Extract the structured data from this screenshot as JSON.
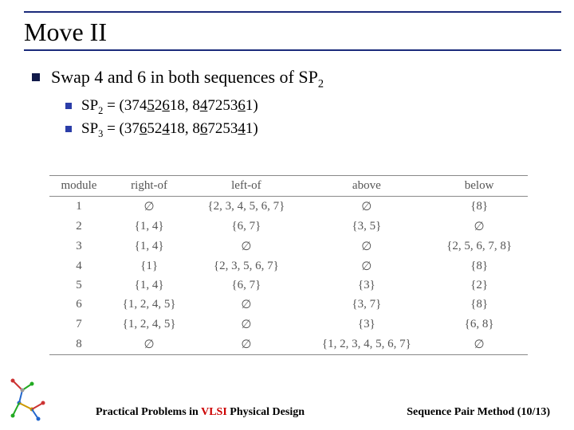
{
  "title": "Move II",
  "main_bullet": {
    "pre": "Swap 4 and 6 in both sequences of SP",
    "sub_num": "2"
  },
  "sp2": {
    "label_pre": "SP",
    "label_sub": "2",
    "eq": " = (374",
    "u1": "5",
    "mid1": "2",
    "u2": "6",
    "mid2": "18, 8",
    "u3": "4",
    "mid3": "7253",
    "u4": "6",
    "end": "1)"
  },
  "sp3": {
    "label_pre": "SP",
    "label_sub": "3",
    "eq": " = (37",
    "u1": "6",
    "mid1": "52",
    "u2": "4",
    "mid2": "18, 8",
    "u3": "6",
    "mid3": "7253",
    "u4": "4",
    "end": "1)"
  },
  "table": {
    "headers": [
      "module",
      "right-of",
      "left-of",
      "above",
      "below"
    ],
    "rows": [
      [
        "1",
        "∅",
        "{2, 3, 4, 5, 6, 7}",
        "∅",
        "{8}"
      ],
      [
        "2",
        "{1, 4}",
        "{6, 7}",
        "{3, 5}",
        "∅"
      ],
      [
        "3",
        "{1, 4}",
        "∅",
        "∅",
        "{2, 5, 6, 7, 8}"
      ],
      [
        "4",
        "{1}",
        "{2, 3, 5, 6, 7}",
        "∅",
        "{8}"
      ],
      [
        "5",
        "{1, 4}",
        "{6, 7}",
        "{3}",
        "{2}"
      ],
      [
        "6",
        "{1, 2, 4, 5}",
        "∅",
        "{3, 7}",
        "{8}"
      ],
      [
        "7",
        "{1, 2, 4, 5}",
        "∅",
        "{3}",
        "{6, 8}"
      ],
      [
        "8",
        "∅",
        "∅",
        "{1, 2, 3, 4, 5, 6, 7}",
        "∅"
      ]
    ]
  },
  "footer": {
    "left_pre": "Practical Problems in ",
    "left_vlsi": "VLSI",
    "left_post": " Physical Design",
    "right": "Sequence Pair Method (10/13)"
  }
}
